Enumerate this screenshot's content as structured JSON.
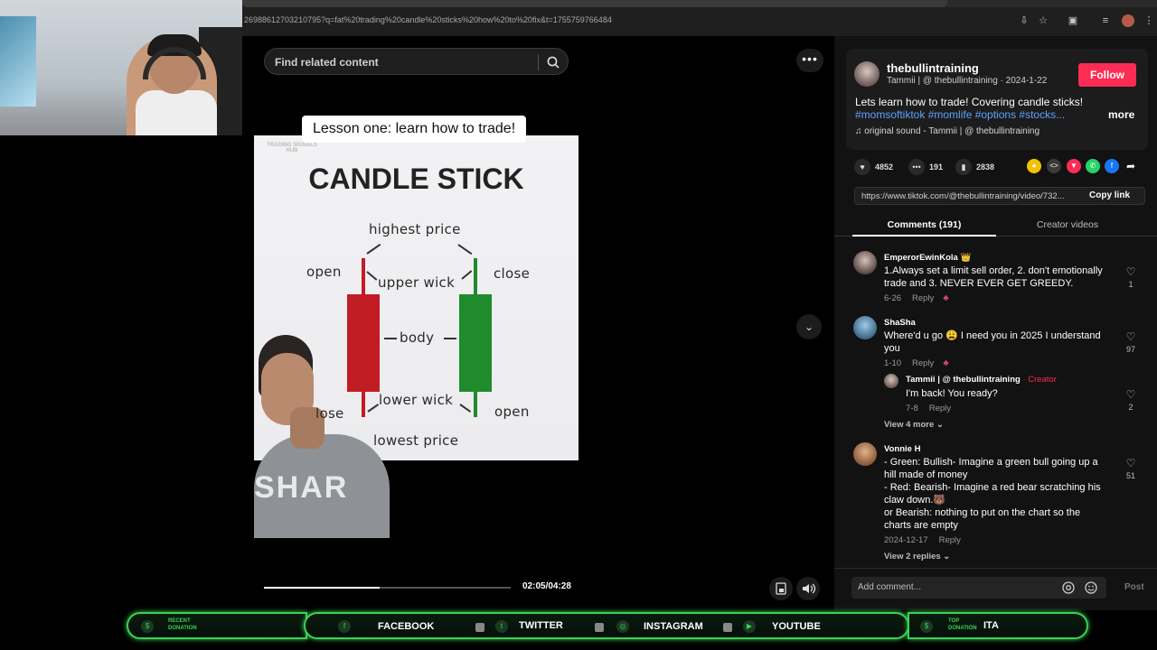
{
  "browser": {
    "url": "26988612703210795?q=fat%20trading%20candle%20sticks%20how%20to%20fix&t=1755759766484"
  },
  "search": {
    "placeholder": "Find related content"
  },
  "video": {
    "overlay_caption": "Lesson one: learn how to trade!",
    "watermark": "TRADING SIGNALS HUB",
    "diagram_title": "CANDLE STICK",
    "labels": {
      "highest_price": "highest price",
      "open_top": "open",
      "upper_wick": "upper wick",
      "close_top": "close",
      "body": "body",
      "close_bottom": "lose",
      "lower_wick": "lower wick",
      "open_bottom": "open",
      "lowest_price": "lowest price"
    },
    "shirt_text": "SHAR",
    "timecode": "02:05/04:28",
    "progress_fraction": 0.47,
    "candle_colors": {
      "bearish": "#c21d25",
      "bullish": "#1f8b2c"
    }
  },
  "author": {
    "name": "thebullintraining",
    "subtitle": "Tammii | @ thebullintraining · 2024-1-22",
    "follow_label": "Follow",
    "caption": "Lets learn how to trade! Covering candle sticks!",
    "hashtags": "#momsoftiktok #momlife #options #stocks...",
    "more_label": "more",
    "sound": "original sound - Tammii | @ thebullintraining"
  },
  "stats": {
    "likes": "4852",
    "comments": "191",
    "saves": "2838"
  },
  "link": {
    "url": "https://www.tiktok.com/@thebullintraining/video/732...",
    "copy_label": "Copy link"
  },
  "tabs": {
    "comments": "Comments (191)",
    "creator": "Creator videos"
  },
  "comments": [
    {
      "user": "EmperorEwinKola 👑",
      "text": "1.Always set a limit sell order, 2. don't emotionally trade and 3. NEVER EVER GET GREEDY.",
      "date": "6-26",
      "reply_label": "Reply",
      "likes": "1"
    },
    {
      "user": "ShaSha",
      "text": "Where'd u go 😩 I need you in 2025 I understand you",
      "date": "1-10",
      "reply_label": "Reply",
      "likes": "97",
      "reply": {
        "user": "Tammii | @ thebullintraining",
        "tag": "· Creator",
        "text": "I'm back! You ready?",
        "date": "7-8",
        "reply_label": "Reply",
        "likes": "2"
      },
      "view_more": "View 4 more ⌄"
    },
    {
      "user": "Vonnie H",
      "text_lines": [
        "- Green: Bullish- Imagine a green bull going up a hill made of money",
        "- Red: Bearish- Imagine a red bear scratching his claw down.🐻",
        "or Bearish: nothing to put on the chart so the charts are empty"
      ],
      "date": "2024-12-17",
      "reply_label": "Reply",
      "likes": "51",
      "view_more": "View 2 replies ⌄"
    }
  ],
  "add_comment": {
    "placeholder": "Add comment...",
    "post_label": "Post"
  },
  "overlay_bar": {
    "recent_donation": "RECENT DONATION",
    "facebook": "FACEBOOK",
    "twitter": "TWITTER",
    "instagram": "INSTAGRAM",
    "youtube": "YOUTUBE",
    "top_donation": "TOP DONATION",
    "top_donation_name": "ITA",
    "accent": "#39d353"
  }
}
